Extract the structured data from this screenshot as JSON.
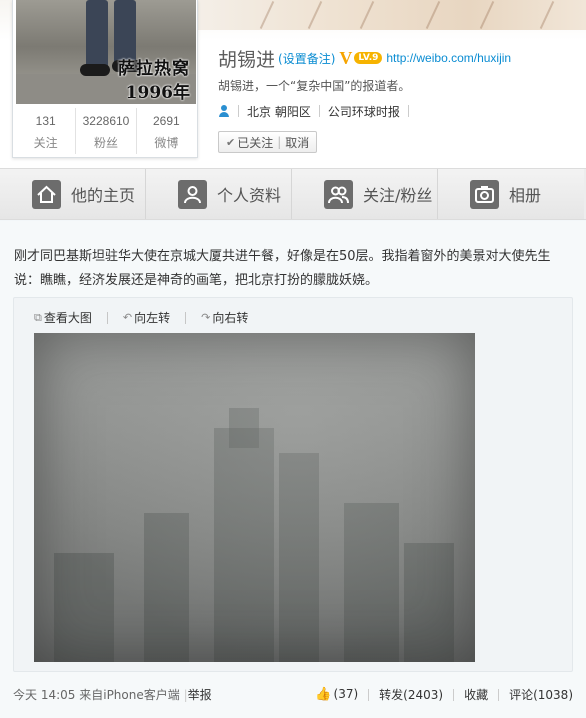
{
  "profile": {
    "avatar_caption_line1": "萨拉热窝",
    "avatar_caption_line2": "1996年",
    "stats": [
      {
        "value": "131",
        "label": "关注"
      },
      {
        "value": "3228610",
        "label": "粉丝"
      },
      {
        "value": "2691",
        "label": "微博"
      }
    ],
    "name": "胡锡进",
    "remark": "(设置备注)",
    "verified_badge": "V",
    "level_badge": "LV.9",
    "url": "http://weibo.com/huxijin",
    "bio": "胡锡进，一个“复杂中国”的报道者。",
    "location": "北京 朝阳区",
    "company": "公司环球时报",
    "follow_state": "已关注",
    "unfollow_label": "取消",
    "icons": {
      "verified": "verified-v-icon",
      "person": "person-icon",
      "check": "check-icon"
    },
    "colors": {
      "link": "#0a8cd2",
      "badge": "#f6b300"
    }
  },
  "nav": {
    "tabs": [
      {
        "label": "他的主页",
        "icon": "home-icon"
      },
      {
        "label": "个人资料",
        "icon": "profile-icon"
      },
      {
        "label": "关注/粉丝",
        "icon": "friends-icon"
      },
      {
        "label": "相册",
        "icon": "camera-icon"
      }
    ]
  },
  "post": {
    "text": "刚才同巴基斯坦驻华大使在京城大厦共进午餐，好像是在50层。我指着窗外的美景对大使先生说：瞧瞧，经济发展还是神奇的画笔，把北京打扮的朦胧妖娆。",
    "tools": [
      {
        "label": "查看大图",
        "icon": "view-large-icon"
      },
      {
        "label": "向左转",
        "icon": "rotate-left-icon"
      },
      {
        "label": "向右转",
        "icon": "rotate-right-icon"
      }
    ],
    "footer": {
      "time": "今天 14:05",
      "source": "来自iPhone客户端",
      "report": "举报",
      "likes": "(37)",
      "repost": "转发(2403)",
      "favorite": "收藏",
      "comment": "评论(1038)"
    }
  }
}
